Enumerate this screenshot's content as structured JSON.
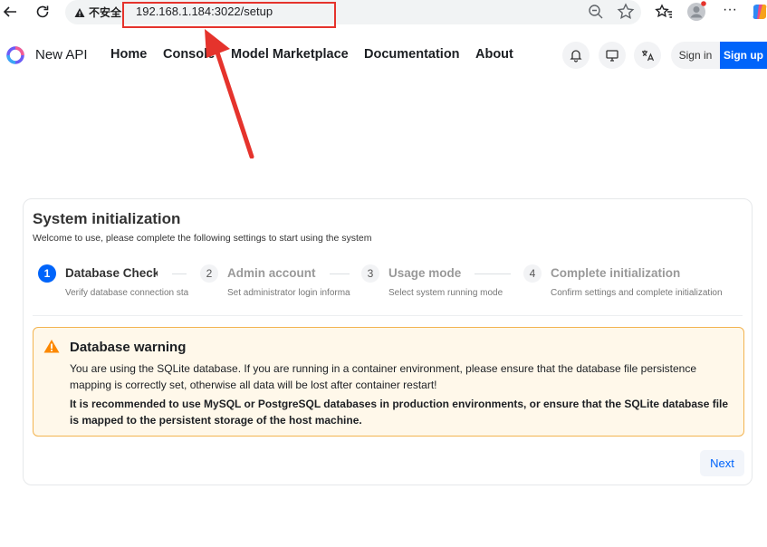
{
  "browser": {
    "insecure_label": "不安全",
    "url": "192.168.1.184:3022/setup"
  },
  "header": {
    "brand": "New API",
    "nav": [
      "Home",
      "Console",
      "Model Marketplace",
      "Documentation",
      "About"
    ],
    "sign_in": "Sign in",
    "sign_up": "Sign up"
  },
  "setup": {
    "title": "System initialization",
    "subtitle": "Welcome to use, please complete the following settings to start using the system",
    "steps": [
      {
        "num": "1",
        "title": "Database Check",
        "desc": "Verify database connection status"
      },
      {
        "num": "2",
        "title": "Admin account",
        "desc": "Set administrator login information"
      },
      {
        "num": "3",
        "title": "Usage mode",
        "desc": "Select system running mode"
      },
      {
        "num": "4",
        "title": "Complete initialization",
        "desc": "Confirm settings and complete initialization"
      }
    ],
    "warning": {
      "title": "Database warning",
      "text": "You are using the SQLite database. If you are running in a container environment, please ensure that the database file persistence mapping is correctly set, otherwise all data will be lost after container restart!",
      "strong": "It is recommended to use MySQL or PostgreSQL databases in production environments, or ensure that the SQLite database file is mapped to the persistent storage of the host machine."
    },
    "next": "Next"
  },
  "colors": {
    "primary": "#0064fa",
    "warning_border": "#f3b451",
    "warning_bg": "#fff8ea",
    "annotation_red": "#e5332c"
  }
}
